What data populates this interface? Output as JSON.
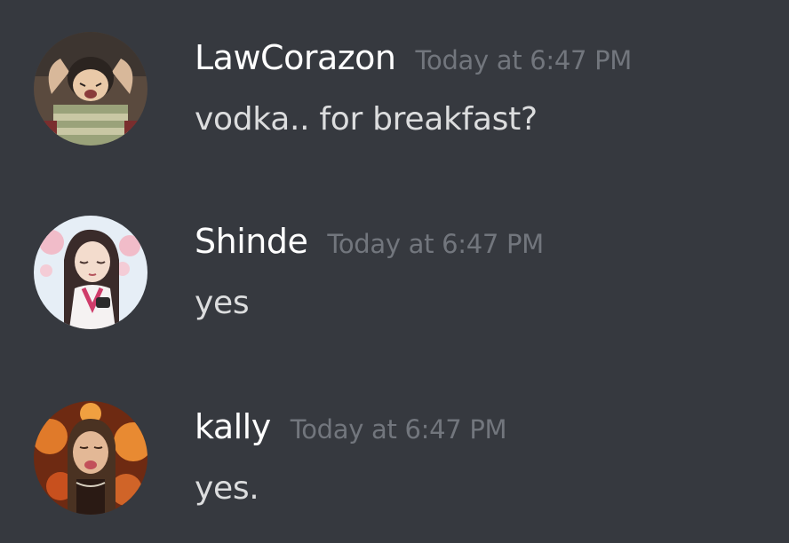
{
  "messages": [
    {
      "username": "LawCorazon",
      "timestamp": "Today at 6:47 PM",
      "content": "vodka.. for breakfast?",
      "avatar_icon": "anime-boy-avatar"
    },
    {
      "username": "Shinde",
      "timestamp": "Today at 6:47 PM",
      "content": "yes",
      "avatar_icon": "anime-girl-kimono-avatar"
    },
    {
      "username": "kally",
      "timestamp": "Today at 6:47 PM",
      "content": "yes.",
      "avatar_icon": "photo-girl-avatar"
    }
  ],
  "colors": {
    "background": "#36393f",
    "username": "#ffffff",
    "timestamp": "#72767d",
    "message_text": "#dcddde"
  }
}
